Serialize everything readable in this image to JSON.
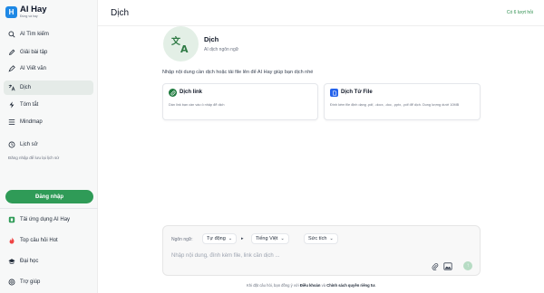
{
  "app": {
    "name": "AI Hay",
    "tagline": "Đúng và hay"
  },
  "sidebar": {
    "items": [
      {
        "label": "AI Tìm kiếm",
        "icon": "search-icon"
      },
      {
        "label": "Giải bài tập",
        "icon": "pencil-icon"
      },
      {
        "label": "AI Viết văn",
        "icon": "pen-icon"
      },
      {
        "label": "Dịch",
        "icon": "translate-icon",
        "active": true
      },
      {
        "label": "Tóm tắt",
        "icon": "lightning-icon"
      },
      {
        "label": "Mindmap",
        "icon": "mindmap-icon"
      },
      {
        "label": "Lịch sử",
        "icon": "clock-icon"
      }
    ],
    "history_note": "Đăng nhập để lưu lại lịch sử",
    "login_label": "Đăng nhập",
    "bottom_items": [
      {
        "label": "Tải ứng dụng AI Hay",
        "icon": "app-download-icon"
      },
      {
        "label": "Top câu hỏi Hot",
        "icon": "fire-icon"
      },
      {
        "label": "Đại học",
        "icon": "graduation-cap-icon"
      },
      {
        "label": "Trợ giúp",
        "icon": "help-icon"
      }
    ]
  },
  "header": {
    "title": "Dịch",
    "link_label": "Có 6 lượt hỏi"
  },
  "hero": {
    "title": "Dịch",
    "subtitle": "AI dịch ngôn ngữ"
  },
  "intro_text": "Nhập nội dung cần dịch hoặc tải file lên để AI Hay giúp bạn dịch nhé",
  "cards": [
    {
      "title": "Dịch link",
      "desc": "Dán link bạn cần vào ô nhập để dịch",
      "icon": "link-icon",
      "color": "#1f7a3e"
    },
    {
      "title": "Dịch Tử File",
      "desc": "Đính kèm file định dạng .pdf, .docx, .doc, .pptx, .pdf để dịch. Dung lượng dưới 10MB",
      "icon": "file-icon",
      "color": "#2563eb"
    }
  ],
  "composer": {
    "lang_label": "Ngôn ngữ:",
    "source_lang": "Tự động",
    "target_lang": "Tiếng Việt",
    "style_label": "Sức tích",
    "placeholder": "Nhập nội dung, đính kèm file, link cần dịch ..."
  },
  "footer": {
    "prefix": "Khi đặt câu hỏi, bạn đồng ý với ",
    "terms": "Điều khoản",
    "middle": " và ",
    "privacy": "Chính sách quyền riêng tư."
  },
  "colors": {
    "accent": "#2f9b57",
    "active_bg": "#e5ebe8",
    "blue": "#2563eb"
  }
}
